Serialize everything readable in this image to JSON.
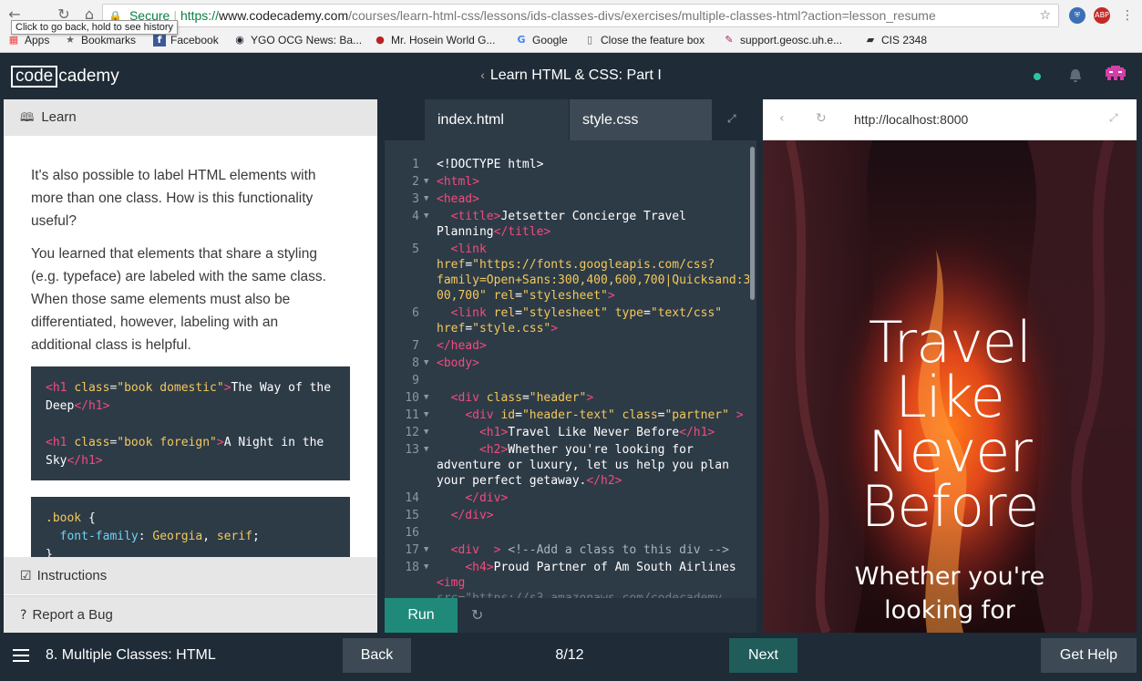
{
  "browser": {
    "tooltip": "Click to go back, hold to see history",
    "secure_label": "Secure",
    "url_scheme": "https://",
    "url_host": "www.codecademy.com",
    "url_path": "/courses/learn-html-css/lessons/ids-classes-divs/exercises/multiple-classes-html?action=lesson_resume",
    "bookmarks": [
      {
        "label": "Apps",
        "icon": "apps-grid-icon"
      },
      {
        "label": "Bookmarks",
        "icon": "star-icon"
      },
      {
        "label": "Facebook",
        "icon": "facebook-icon"
      },
      {
        "label": "YGO OCG News: Ba...",
        "icon": "ygo-icon"
      },
      {
        "label": "Mr. Hosein World G...",
        "icon": "apple-icon"
      },
      {
        "label": "Google",
        "icon": "google-icon"
      },
      {
        "label": "Close the feature box",
        "icon": "page-icon"
      },
      {
        "label": "support.geosc.uh.e...",
        "icon": "feather-icon"
      },
      {
        "label": "CIS 2348",
        "icon": "book-icon"
      }
    ]
  },
  "header": {
    "logo_boxed": "code",
    "logo_rest": "cademy",
    "course_title": "Learn HTML & CSS: Part I"
  },
  "learn": {
    "tab_label": "Learn",
    "paragraph1": "It's also possible to label HTML elements with more than one class. How is this functionality useful?",
    "paragraph2": "You learned that elements that share a styling (e.g. typeface) are labeled with the same class. When those same elements must also be differentiated, however, labeling with an additional class is helpful.",
    "instructions_label": "Instructions",
    "report_label": "Report a Bug"
  },
  "editor": {
    "tab_active": "index.html",
    "tab_inactive": "style.css",
    "run_label": "Run"
  },
  "preview": {
    "url": "http://localhost:8000",
    "hero_title": "Travel Like Never Before",
    "hero_sub": "Whether you're looking for"
  },
  "footer": {
    "lesson_name": "8. Multiple Classes: HTML",
    "back_label": "Back",
    "progress": "8/12",
    "next_label": "Next",
    "help_label": "Get Help"
  },
  "colors": {
    "app_bg": "#1f2b36",
    "editor_bg": "#2d3b47",
    "accent_teal": "#1f8a7a",
    "tag_pink": "#f24b7e",
    "attr_yellow": "#f4c85a"
  }
}
